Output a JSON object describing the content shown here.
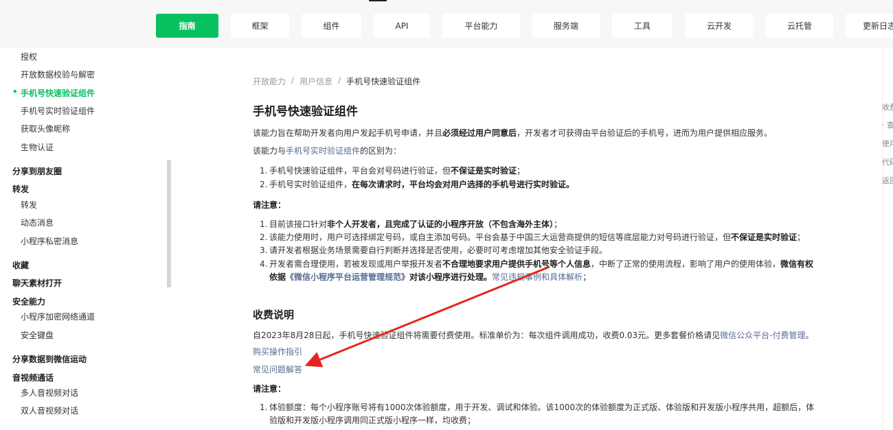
{
  "nav": {
    "items": [
      "指南",
      "框架",
      "组件",
      "API",
      "平台能力",
      "服务端",
      "工具",
      "云开发",
      "云托管",
      "更新日志"
    ],
    "active_index": 0
  },
  "sidebar": {
    "items": [
      {
        "label": "授权",
        "kind": "child"
      },
      {
        "label": "开放数据校验与解密",
        "kind": "child"
      },
      {
        "label": "手机号快速验证组件",
        "kind": "child",
        "active": true
      },
      {
        "label": "手机号实时验证组件",
        "kind": "child"
      },
      {
        "label": "获取头像昵称",
        "kind": "child"
      },
      {
        "label": "生物认证",
        "kind": "child"
      },
      {
        "label": "分享到朋友圈",
        "kind": "group"
      },
      {
        "label": "转发",
        "kind": "group"
      },
      {
        "label": "转发",
        "kind": "child"
      },
      {
        "label": "动态消息",
        "kind": "child"
      },
      {
        "label": "小程序私密消息",
        "kind": "child"
      },
      {
        "label": "收藏",
        "kind": "group"
      },
      {
        "label": "聊天素材打开",
        "kind": "group"
      },
      {
        "label": "安全能力",
        "kind": "group"
      },
      {
        "label": "小程序加密网络通道",
        "kind": "child"
      },
      {
        "label": "安全键盘",
        "kind": "child"
      },
      {
        "label": "分享数据到微信运动",
        "kind": "group"
      },
      {
        "label": "音视频通话",
        "kind": "group"
      },
      {
        "label": "多人音视频对话",
        "kind": "child"
      },
      {
        "label": "双人音视频对话",
        "kind": "child"
      }
    ],
    "active_bullet": "•"
  },
  "breadcrumb": {
    "items": [
      "开放能力",
      "用户信息",
      "手机号快速验证组件"
    ],
    "separator": "/"
  },
  "content": {
    "title": "手机号快速验证组件",
    "intro": {
      "a": "该能力旨在帮助开发者向用户发起手机号申请，并且",
      "b": "必须经过用户同意后",
      "c": "，开发者才可获得由平台验证后的手机号，进而为用户提供相应服务。"
    },
    "diff": {
      "a": "该能力与",
      "link": "手机号实时验证组件",
      "b": "的区别为："
    },
    "diff_list": [
      {
        "num": "1.",
        "a": "手机号快速验证组件，平台会对号码进行验证，但",
        "b": "不保证是实时验证",
        "c": "；"
      },
      {
        "num": "2.",
        "a": "手机号实时验证组件，",
        "b": "在每次请求时，平台均会对用户选择的手机号进行实时验证。",
        "c": ""
      }
    ],
    "note_label": "请注意：",
    "notes": {
      "n1": {
        "num": "1.",
        "a": "目前该接口针对",
        "b": "非个人开发者，且完成了认证的小程序开放（不包含海外主体）",
        "c": "；"
      },
      "n2": {
        "num": "2.",
        "a": "该能力使用时，用户可选择绑定号码，或自主添加号码。平台会基于中国三大运营商提供的短信等底层能力对号码进行验证，但",
        "b": "不保证是实时验证",
        "c": "；"
      },
      "n3": {
        "num": "3.",
        "a": "请开发者根据业务场景需要自行判断并选择是否使用，必要时可考虑增加其他安全验证手段。"
      },
      "n4": {
        "num": "4.",
        "a": "开发者需合理使用，若被发现或用户举报开发者",
        "b": "不合理地要求用户提供手机号等个人信息",
        "c": "，中断了正常的使用流程，影响了用户的使用体验，",
        "d": "微信有权",
        "e": "依据",
        "f_link": "《微信小程序平台运营管理规范》",
        "g": "对该小程序进行处理。",
        "h_link": "常见违规事例和具体解析",
        "i": "；"
      }
    },
    "fee": {
      "title": "收费说明",
      "text_a": "自2023年8月28日起，手机号快速验证组件将需要付费使用。标准单价为：每次组件调用成功，收费0.03元。更多套餐价格请见",
      "text_link": "微信公众平台-付费管理",
      "text_b": "。",
      "buy_link": "购买操作指引",
      "faq_link": "常见问题解答",
      "note_label": "请注意：",
      "n1": {
        "num": "1.",
        "a": "体验额度：每个小程序账号将有1000次体验额度，用于开发、调试和体验。该1000次的体验额度为正式版、体验版和开发版小程序共用，超额后，体",
        "b": "验版和开发版小程序调用同正式版小程序一样，均收费；"
      }
    }
  },
  "toc": {
    "items": [
      "收费说明",
      "· 查看",
      "使用方法",
      "代码示例",
      "返回参数"
    ]
  },
  "colors": {
    "accent": "#07c160",
    "link": "#576b95",
    "annotation_arrow": "#e8241f"
  }
}
